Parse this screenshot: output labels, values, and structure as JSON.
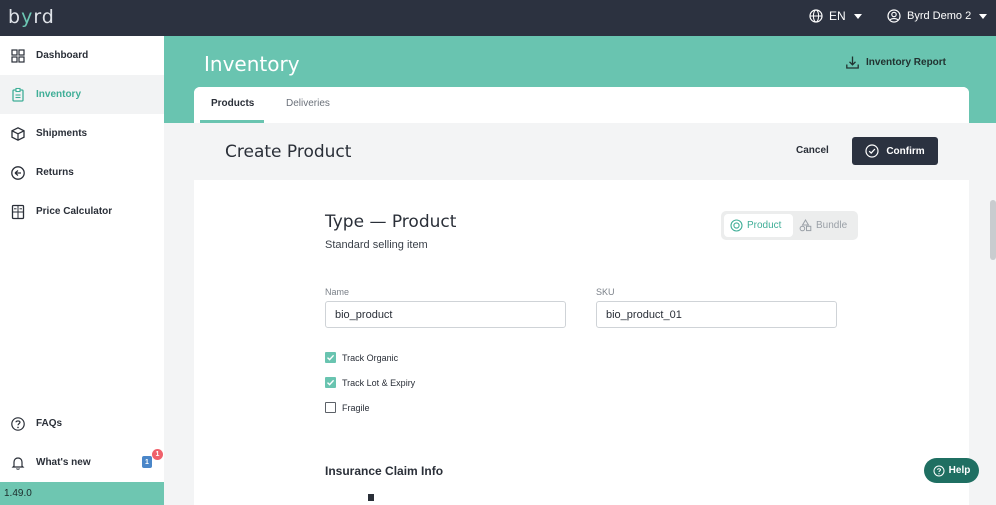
{
  "app": {
    "logo_left": "b",
    "logo_accent": "y",
    "logo_right": "rd"
  },
  "topbar": {
    "language": "EN",
    "user_name": "Byrd Demo 2"
  },
  "sidebar": {
    "items": [
      {
        "label": "Dashboard",
        "icon": "grid-icon"
      },
      {
        "label": "Inventory",
        "icon": "clipboard-icon"
      },
      {
        "label": "Shipments",
        "icon": "box-icon"
      },
      {
        "label": "Returns",
        "icon": "return-icon"
      },
      {
        "label": "Price Calculator",
        "icon": "calculator-icon"
      }
    ],
    "faqs": "FAQs",
    "whats_new": "What's new",
    "whats_new_count": "1",
    "notification_count": "1",
    "version": "1.49.0"
  },
  "banner": {
    "title": "Inventory",
    "report_label": "Inventory Report"
  },
  "tabs": [
    {
      "label": "Products"
    },
    {
      "label": "Deliveries"
    }
  ],
  "header": {
    "title": "Create Product",
    "cancel_label": "Cancel",
    "confirm_label": "Confirm"
  },
  "form": {
    "type_title": "Type — Product",
    "type_subtitle": "Standard selling item",
    "toggle_product": "Product",
    "toggle_bundle": "Bundle",
    "name_label": "Name",
    "name_value": "bio_product",
    "sku_label": "SKU",
    "sku_value": "bio_product_01",
    "checks": [
      {
        "label": "Track Organic",
        "checked": true
      },
      {
        "label": "Track Lot & Expiry",
        "checked": true
      },
      {
        "label": "Fragile",
        "checked": false
      }
    ],
    "insurance_title": "Insurance Claim Info"
  },
  "help": {
    "label": "Help"
  },
  "colors": {
    "teal": "#69c4b0",
    "dark": "#2c3240",
    "active_text": "#3fae97",
    "badge_red": "#f0616b",
    "badge_blue": "#4a86c8"
  }
}
